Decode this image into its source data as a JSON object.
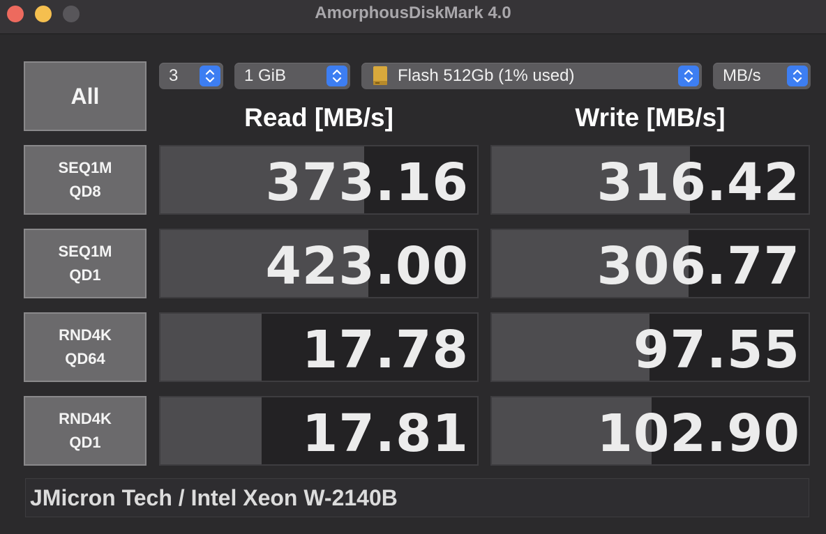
{
  "window": {
    "title": "AmorphousDiskMark 4.0"
  },
  "controls": {
    "all_label": "All",
    "count": "3",
    "size": "1 GiB",
    "disk": "Flash 512Gb (1% used)",
    "unit": "MB/s"
  },
  "headers": {
    "read": "Read [MB/s]",
    "write": "Write [MB/s]"
  },
  "max_scale": 1000,
  "rows": [
    {
      "line1": "SEQ1M",
      "line2": "QD8",
      "read": "373.16",
      "write": "316.42",
      "read_value": 373.16,
      "write_value": 316.42
    },
    {
      "line1": "SEQ1M",
      "line2": "QD1",
      "read": "423.00",
      "write": "306.77",
      "read_value": 423.0,
      "write_value": 306.77
    },
    {
      "line1": "RND4K",
      "line2": "QD64",
      "read": "17.78",
      "write": "97.55",
      "read_value": 17.78,
      "write_value": 97.55
    },
    {
      "line1": "RND4K",
      "line2": "QD1",
      "read": "17.81",
      "write": "102.90",
      "read_value": 17.81,
      "write_value": 102.9
    }
  ],
  "footer": {
    "text": "JMicron Tech / Intel Xeon W-2140B"
  },
  "colors": {
    "accent": "#3d7ef2",
    "close": "#ed6a5e",
    "minimize": "#f5bf4f"
  }
}
